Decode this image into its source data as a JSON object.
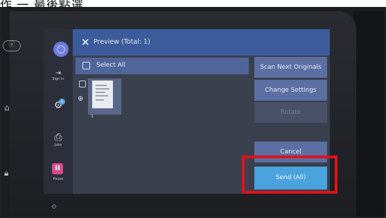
{
  "caption": {
    "text": "作 一 最後點選 "
  },
  "hardware": {
    "left_button": "ⓞ",
    "home_icon": "home-icon",
    "lock_icon": "lock-icon"
  },
  "nav": {
    "items": [
      {
        "name": "sign-in",
        "label": "Sign In"
      },
      {
        "name": "settings",
        "label": "",
        "badge": "1"
      },
      {
        "name": "jobs",
        "label": "Jobs"
      },
      {
        "name": "pause",
        "label": "Pause"
      }
    ]
  },
  "header": {
    "title": "Preview (Total: 1)"
  },
  "content": {
    "select_all": "Select All",
    "page_number": "1"
  },
  "actions": {
    "scan_next": "Scan Next Originals",
    "change_settings": "Change Settings",
    "rotate": "Rotate",
    "cancel": "Cancel",
    "send": "Send (All)"
  },
  "colors": {
    "accent": "#3c5b9b",
    "send": "#4aa3dc",
    "highlight": "#e0131b"
  }
}
